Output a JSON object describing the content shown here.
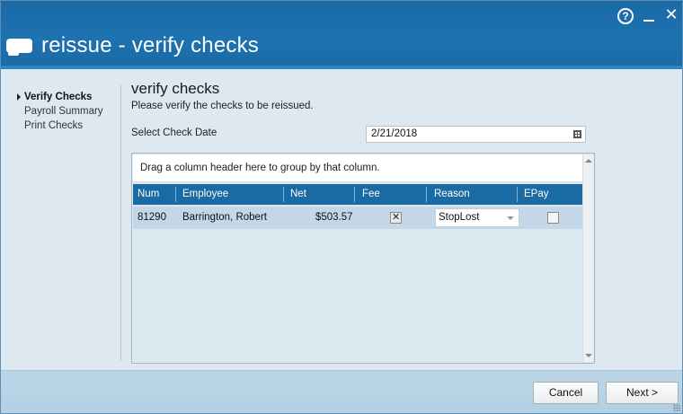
{
  "window": {
    "title": "reissue - verify checks",
    "help_label": "?",
    "close_label": "✕"
  },
  "nav": {
    "items": [
      {
        "label": "Verify Checks",
        "active": true
      },
      {
        "label": "Payroll Summary",
        "active": false
      },
      {
        "label": "Print Checks",
        "active": false
      }
    ]
  },
  "section": {
    "title": "verify checks",
    "description": "Please verify the checks to be reissued."
  },
  "check_date": {
    "label": "Select Check Date",
    "value": "2/21/2018"
  },
  "grid": {
    "group_panel_text": "Drag a column header here to group by that column.",
    "columns": [
      "Num",
      "Employee",
      "Net",
      "Fee",
      "Reason",
      "EPay"
    ],
    "rows": [
      {
        "num": "81290",
        "employee": "Barrington, Robert",
        "net": "$503.57",
        "fee": true,
        "reason": "StopLost",
        "epay": false
      }
    ]
  },
  "buttons": {
    "cancel": "Cancel",
    "next": "Next >"
  },
  "icons": {
    "app": "app-logo-icon",
    "help": "help-icon",
    "minimize": "minimize-icon",
    "close": "close-icon",
    "calendar": "calendar-icon",
    "nav_current": "triangle-right-icon",
    "dropdown": "chevron-down-icon"
  }
}
